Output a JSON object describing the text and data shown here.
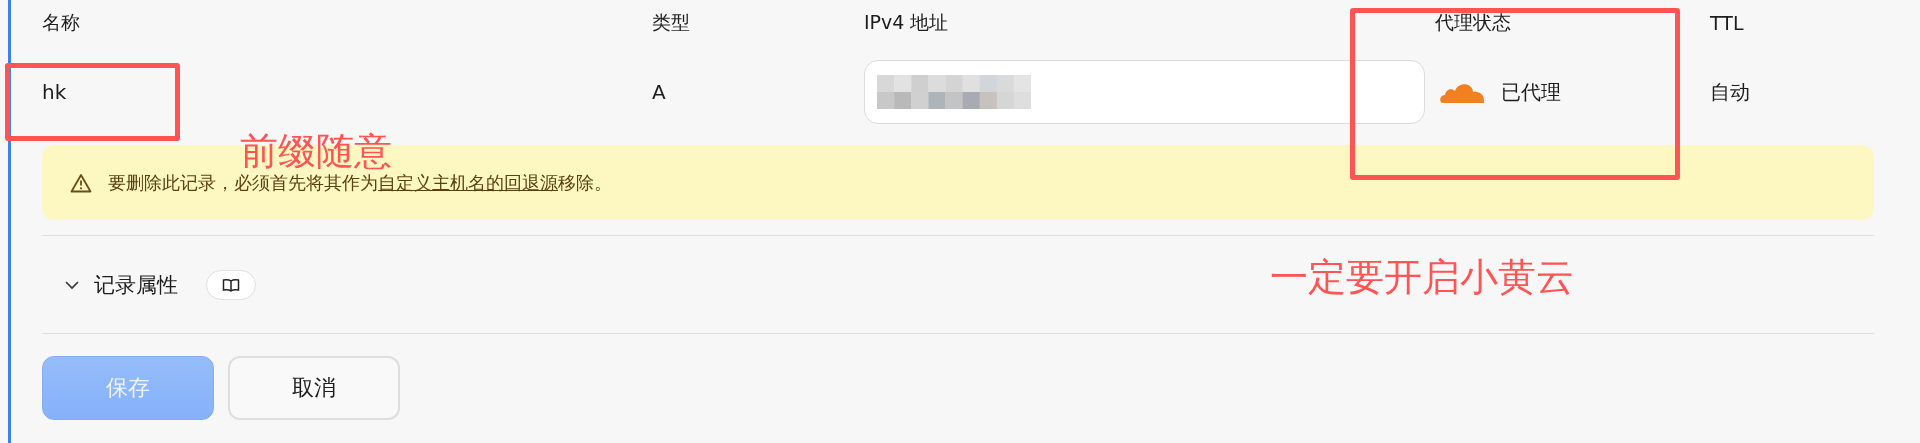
{
  "columns": [
    "名称",
    "类型",
    "IPv4 地址",
    "代理状态",
    "TTL"
  ],
  "record": {
    "name": "hk",
    "type": "A",
    "ipv4_redacted": true,
    "proxied": true,
    "proxy_label": "已代理",
    "ttl": "自动"
  },
  "warning": {
    "before": "要删除此记录，必须首先将其作为",
    "link": "自定义主机名的回退源",
    "after": "移除。"
  },
  "section": {
    "label": "记录属性",
    "expanded": false
  },
  "buttons": [
    {
      "label": "保存",
      "kind": "primary",
      "disabled": true
    },
    {
      "label": "取消",
      "kind": "secondary",
      "disabled": false
    }
  ],
  "annotations": [
    {
      "kind": "name_frame"
    },
    {
      "kind": "name_note",
      "text": "前缀随意"
    },
    {
      "kind": "proxy_frame"
    },
    {
      "kind": "proxy_note",
      "text": "一定要开启小黄云"
    }
  ]
}
